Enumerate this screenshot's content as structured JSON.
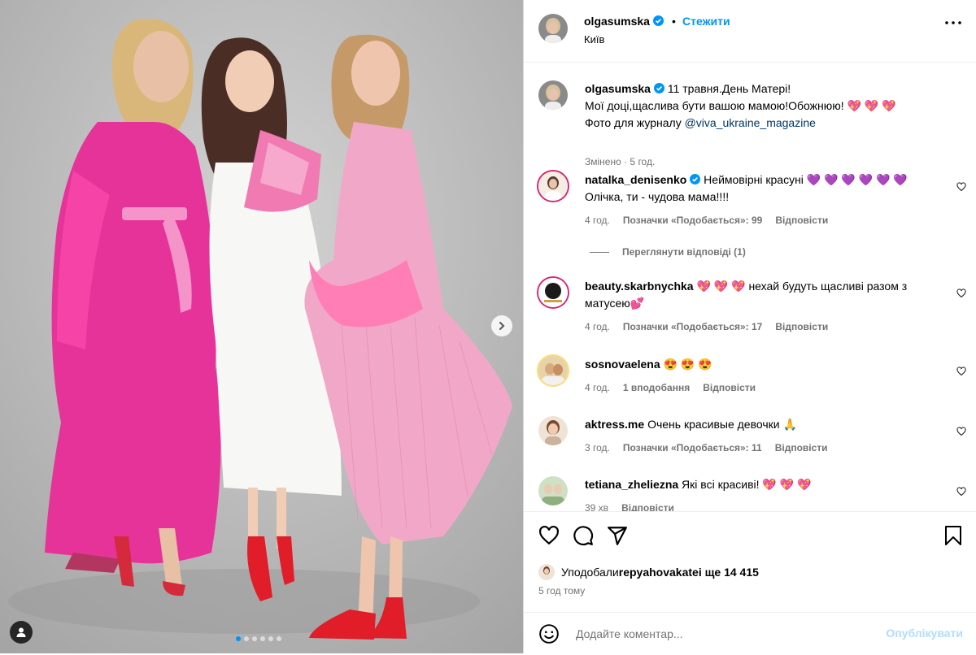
{
  "post": {
    "author": "olgasumska",
    "follow_label": "Стежити",
    "separator": "•",
    "location": "Київ",
    "caption_line1": "11 травня.День Матері!",
    "caption_line2": "Мої доці,щаслива бути вашою мамою!Обожнюю! 💖 💖 💖",
    "caption_line3_prefix": "Фото для журналу ",
    "caption_mention": "@viva_ukraine_magazine",
    "caption_meta": "Змінено · 5 год.",
    "slide_count": 6,
    "active_slide": 1
  },
  "comments": [
    {
      "user": "natalka_denisenko",
      "verified": true,
      "text": "Неймовірні красуні 💜 💜 💜 💜 💜 💜",
      "text_line2": "Олічка, ти - чудова мама!!!!",
      "time": "4 год.",
      "likes": "Позначки «Подобається»: 99",
      "reply": "Відповісти",
      "view_replies": "Переглянути відповіді (1)"
    },
    {
      "user": "beauty.skarbnychka",
      "text": "💖 💖 💖 нехай будуть щасливі разом з матусею💕",
      "time": "4 год.",
      "likes": "Позначки «Подобається»: 17",
      "reply": "Відповісти"
    },
    {
      "user": "sosnovaelena",
      "text": "😍 😍 😍",
      "time": "4 год.",
      "likes": "1 вподобання",
      "reply": "Відповісти"
    },
    {
      "user": "aktress.me",
      "text": "Очень красивые девочки 🙏",
      "time": "3 год.",
      "likes": "Позначки «Подобається»: 11",
      "reply": "Відповісти"
    },
    {
      "user": "tetiana_zheliezna",
      "text": "Які всі красиві! 💖 💖 💖",
      "time": "39 хв",
      "reply": "Відповісти"
    }
  ],
  "footer": {
    "liked_by_prefix": "Уподобали ",
    "liked_by_user": "repyahovakate",
    "liked_by_suffix": " і ще 14 415",
    "time": "5 год тому",
    "comment_placeholder": "Додайте коментар...",
    "post_label": "Опублікувати"
  },
  "colors": {
    "link": "#0095f6",
    "mention": "#00376b",
    "muted": "#737373",
    "post_disabled": "#b3dbff",
    "like_heart": "#ff3040"
  },
  "icons": [
    "more-icon",
    "verified-icon",
    "heart-icon",
    "comment-icon",
    "share-icon",
    "save-icon",
    "emoji-icon",
    "user-tag-icon",
    "chevron-right-icon"
  ]
}
